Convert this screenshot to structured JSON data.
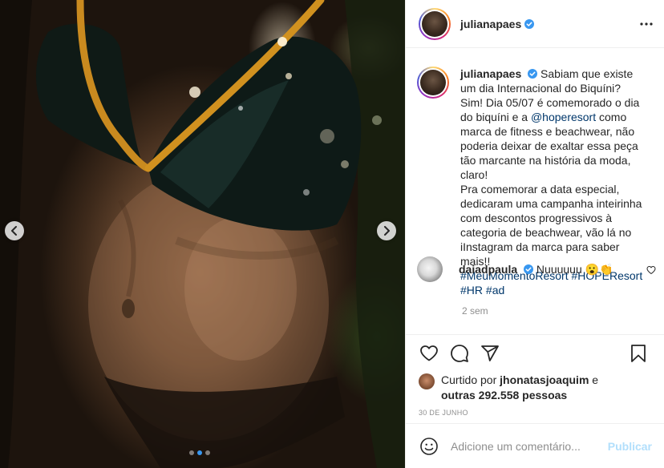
{
  "author": {
    "username": "julianapaes",
    "verified": true
  },
  "caption": {
    "text_1": "Sabiam que existe um dia Internacional do Biquíni? Sim! Dia 05/07 é comemorado o dia do biquíni e a ",
    "mention": "@hoperesort",
    "text_2": " como marca de fitness e beachwear, não poderia deixar de exaltar essa peça tão marcante na história da moda, claro!",
    "text_3": "Pra comemorar a data especial, dedicaram uma campanha inteirinha com descontos progressivos à categoria de beachwear, vão lá no iInstagram da marca para saber mais!!",
    "hashtag_1": "#MeuMomentoResort",
    "hashtag_2": "#HOPEResort",
    "hashtag_3": "#HR",
    "hashtag_4": "#ad",
    "age": "2 sem"
  },
  "comment": {
    "username": "daiadpaula",
    "verified": true,
    "text": "Nuuuuuu 😮👏"
  },
  "likes": {
    "prefix": "Curtido por ",
    "user": "jhonatasjoaquim",
    "connector": " e",
    "others": "outras 292.558 pessoas"
  },
  "date": "30 DE JUNHO",
  "add_comment": {
    "placeholder": "Adicione um comentário...",
    "publish_label": "Publicar"
  },
  "carousel": {
    "count": 3,
    "active_index": 1
  },
  "icons": {
    "more": "more-horizontal-icon",
    "prev": "chevron-left-icon",
    "next": "chevron-right-icon",
    "like": "heart-icon",
    "comment": "comment-bubble-icon",
    "share": "send-icon",
    "save": "bookmark-icon",
    "emoji": "emoji-icon",
    "verified": "verified-badge-icon"
  },
  "colors": {
    "accent": "#0095f6",
    "publish": "#b2dffc",
    "meta": "#8e8e8e",
    "link": "#00376b"
  }
}
